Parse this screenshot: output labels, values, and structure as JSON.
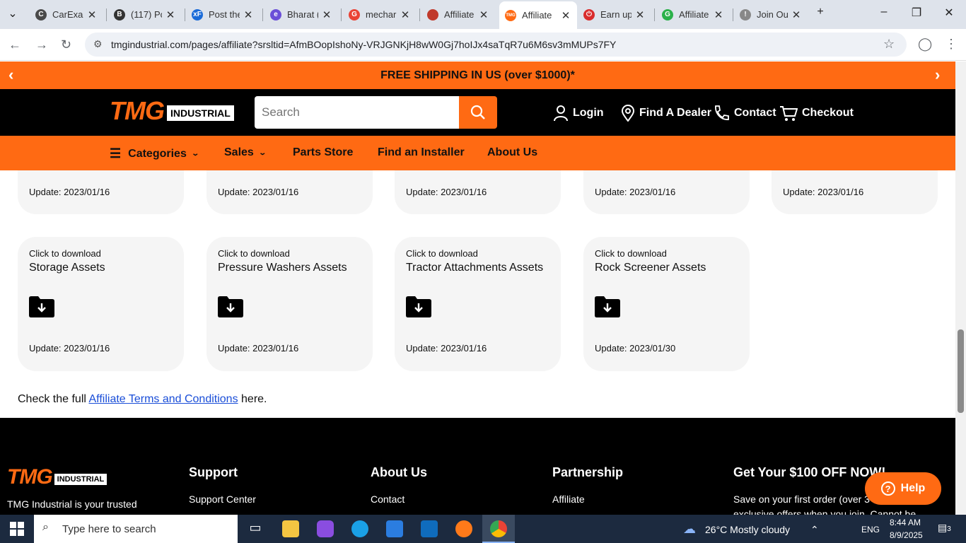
{
  "browser": {
    "tabs": [
      {
        "title": "CarExam",
        "color": "#4a4a4a",
        "glyph": "C"
      },
      {
        "title": "(117) Pc",
        "color": "#333",
        "glyph": "B"
      },
      {
        "title": "Post the",
        "color": "#1a6bd8",
        "glyph": "xF"
      },
      {
        "title": "Bharat (",
        "color": "#6b4fd8",
        "glyph": "e"
      },
      {
        "title": "mechar",
        "color": "#ea4335",
        "glyph": "G"
      },
      {
        "title": "Affiliate",
        "color": "#c0392b",
        "glyph": ""
      },
      {
        "title": "Affiliate",
        "color": "#ff6a13",
        "glyph": "TMG"
      },
      {
        "title": "Earn up",
        "color": "#d92c2c",
        "glyph": "⏻"
      },
      {
        "title": "Affiliate",
        "color": "#2bb14a",
        "glyph": "G"
      },
      {
        "title": "Join Ou",
        "color": "#888",
        "glyph": "!"
      }
    ],
    "new_tab": "+",
    "url": "tmgindustrial.com/pages/affiliate?srsltid=AfmBOopIshoNy-VRJGNKjH8wW0Gj7hoIJx4saTqR7u6M6sv3mMUPs7FY"
  },
  "promo": {
    "text": "FREE SHIPPING IN US (over $1000)*",
    "prev": "‹",
    "next": "›"
  },
  "header": {
    "logo_main": "TMG",
    "logo_sub": "INDUSTRIAL",
    "search_placeholder": "Search",
    "login": "Login",
    "dealer": "Find A Dealer",
    "contact": "Contact",
    "checkout": "Checkout"
  },
  "menu": {
    "categories": "Categories",
    "sales": "Sales",
    "parts": "Parts Store",
    "installer": "Find an Installer",
    "about": "About Us"
  },
  "cards_top": [
    {
      "update": "Update: 2023/01/16"
    },
    {
      "update": "Update: 2023/01/16"
    },
    {
      "update": "Update: 2023/01/16"
    },
    {
      "update": "Update: 2023/01/16"
    },
    {
      "update": "Update: 2023/01/16"
    }
  ],
  "cards": [
    {
      "cta": "Click to download",
      "name": "Storage Assets",
      "update": "Update: 2023/01/16"
    },
    {
      "cta": "Click to download",
      "name": "Pressure Washers Assets",
      "update": "Update: 2023/01/16"
    },
    {
      "cta": "Click to download",
      "name": "Tractor Attachments Assets",
      "update": "Update: 2023/01/16"
    },
    {
      "cta": "Click to download",
      "name": "Rock Screener Assets",
      "update": "Update: 2023/01/30"
    }
  ],
  "terms": {
    "prefix": "Check the full ",
    "link": "Affiliate Terms and Conditions",
    "suffix": " here."
  },
  "footer": {
    "logo_main": "TMG",
    "logo_sub": "INDUSTRIAL",
    "tagline": "TMG Industrial is your trusted",
    "support": "Support",
    "support_link": "Support Center",
    "about": "About Us",
    "about_link": "Contact",
    "partnership": "Partnership",
    "partnership_link": "Affiliate",
    "offer": "Get Your $100 OFF NOW!",
    "offer_text": "Save on your first order (over 3",
    "offer_text2": "exclusive offers when you join. Cannot be"
  },
  "help": "Help",
  "taskbar": {
    "search": "Type here to search",
    "weather": "26°C  Mostly cloudy",
    "lang": "ENG",
    "time": "8:44 AM",
    "date": "8/9/2025",
    "notif": "3"
  }
}
